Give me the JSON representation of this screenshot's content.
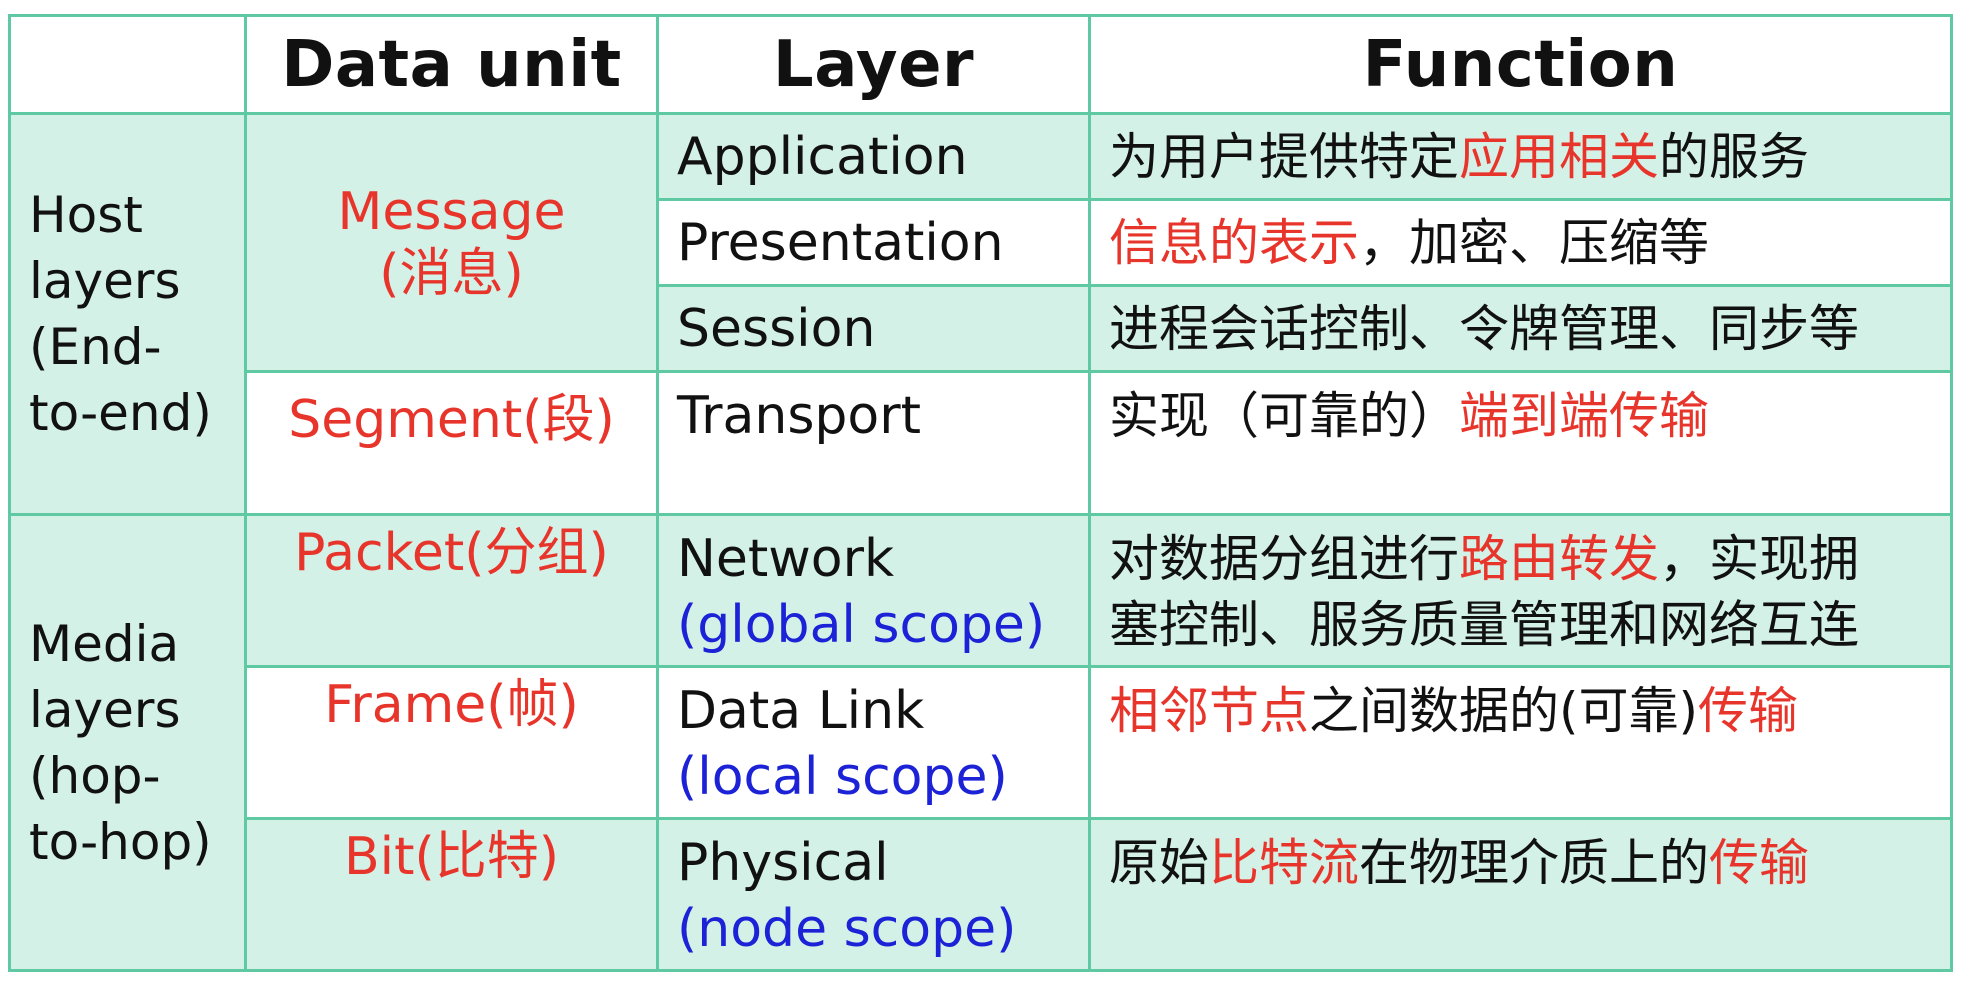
{
  "headers": {
    "blank": "",
    "data_unit": "Data unit",
    "layer": "Layer",
    "function": "Function"
  },
  "groups": {
    "host": {
      "lines": [
        "Host",
        "layers",
        "(End-",
        "to-end)"
      ]
    },
    "media": {
      "lines": [
        "Media",
        "layers",
        "(hop-",
        "to-hop)"
      ]
    }
  },
  "units": {
    "message": {
      "name": "Message",
      "zh": "(消息)"
    },
    "segment": {
      "text": "Segment(段)"
    },
    "packet": {
      "text": "Packet(分组)"
    },
    "frame": {
      "text": "Frame(帧)"
    },
    "bit": {
      "text": "Bit(比特)"
    }
  },
  "layers": {
    "application": {
      "name": "Application"
    },
    "presentation": {
      "name": "Presentation"
    },
    "session": {
      "name": "Session"
    },
    "transport": {
      "name": "Transport"
    },
    "network": {
      "name": "Network",
      "scope": "(global scope)"
    },
    "datalink": {
      "name": "Data Link",
      "scope": "(local scope)"
    },
    "physical": {
      "name": "Physical",
      "scope": "(node scope)"
    }
  },
  "functions": {
    "application": {
      "p1": "为用户提供特定",
      "h1": "应用相关",
      "p2": "的服务"
    },
    "presentation": {
      "h1": "信息的表示",
      "p1": "，加密、压缩等"
    },
    "session": {
      "p1": "进程会话控制、令牌管理、同步等"
    },
    "transport": {
      "p1": "实现（可靠的）",
      "h1": "端到端传输"
    },
    "network": {
      "p1": "对数据分组进行",
      "h1": "路由转发",
      "p2": "，实现拥",
      "line2": "塞控制、服务质量管理和网络互连"
    },
    "datalink": {
      "h1": "相邻节点",
      "p1": "之间数据的(可靠)",
      "h2": "传输"
    },
    "physical": {
      "p1": "原始",
      "h1": "比特流",
      "p2": "在物理介质上的",
      "h2": "传输"
    }
  },
  "colors": {
    "border": "#5fc9a3",
    "fill": "#d4f1e8",
    "highlight_red": "#e8352b",
    "scope_blue": "#1c22d6",
    "text": "#111111"
  }
}
